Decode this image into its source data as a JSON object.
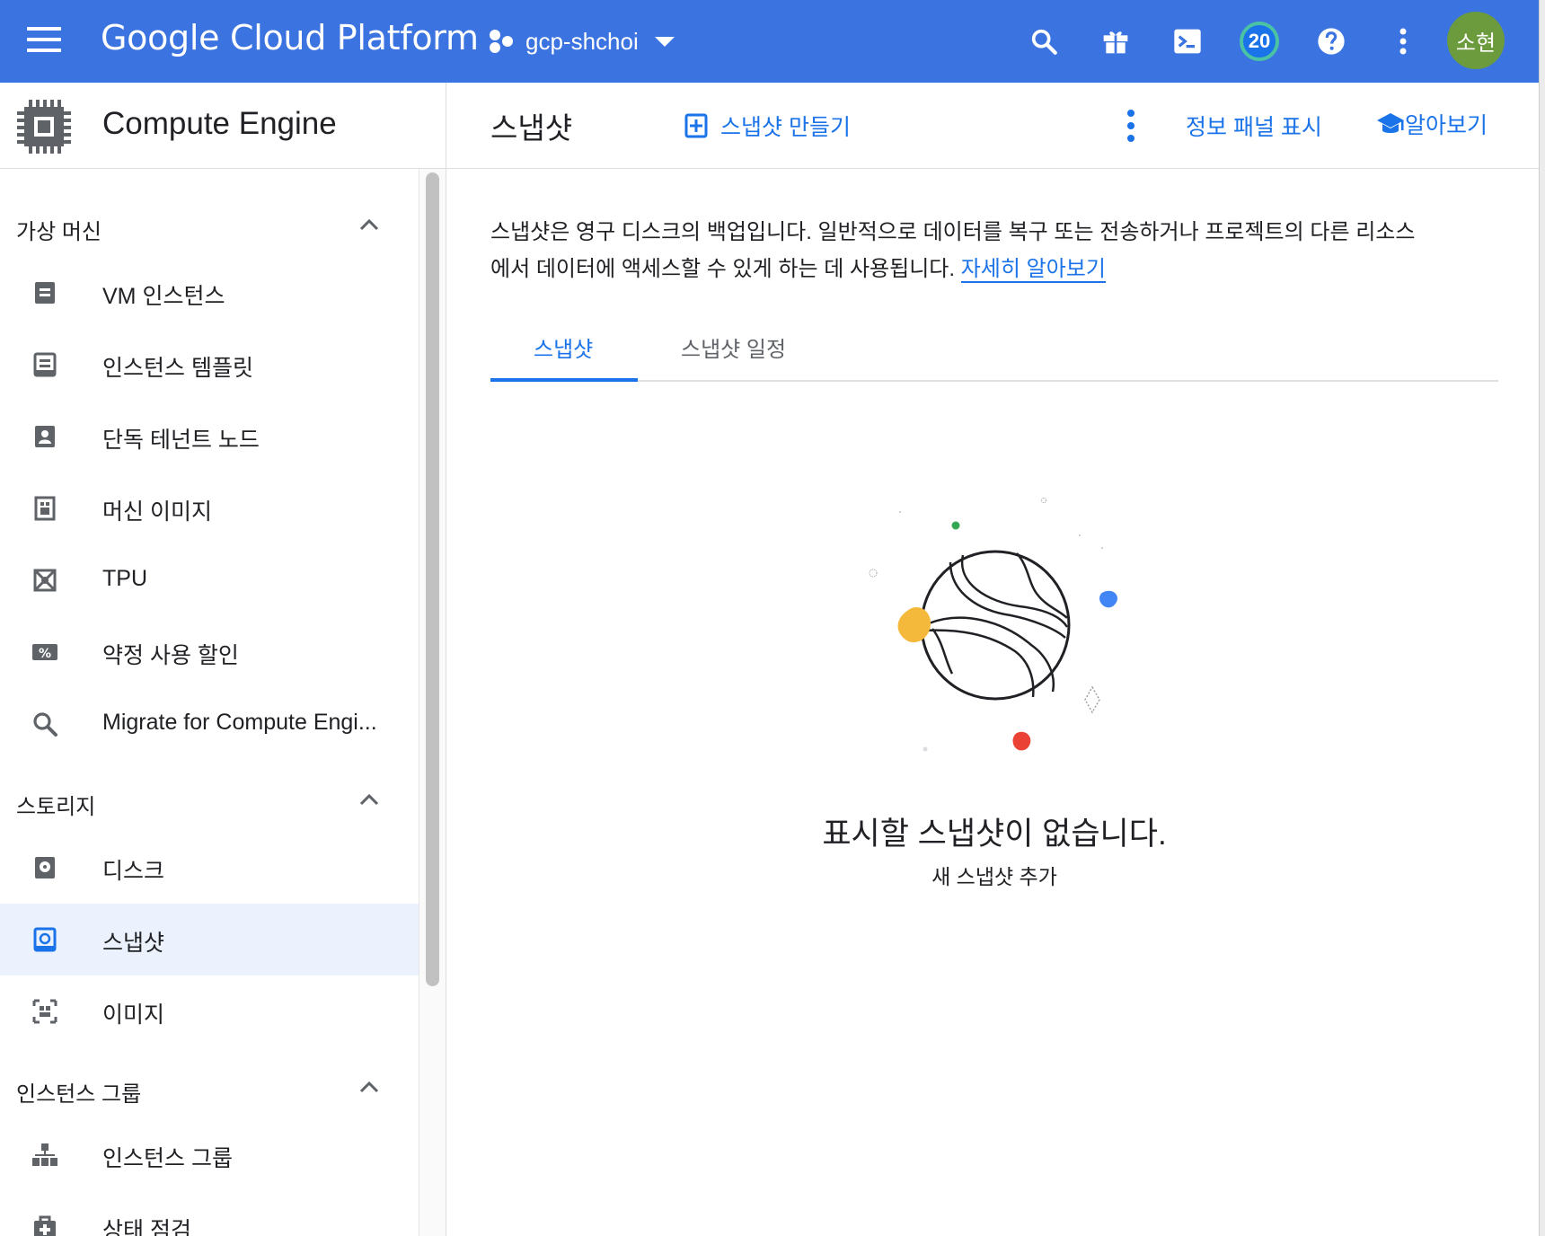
{
  "topbar": {
    "brand": "Google Cloud Platform",
    "project": "gcp-shchoi",
    "notifications_count": "20",
    "avatar_text": "소현"
  },
  "sidebar": {
    "product_title": "Compute Engine",
    "sections": [
      {
        "label": "가상 머신"
      },
      {
        "label": "스토리지"
      },
      {
        "label": "인스턴스 그룹"
      }
    ],
    "items": [
      {
        "label": "VM 인스턴스",
        "icon": "vm-instance-icon"
      },
      {
        "label": "인스턴스 템플릿",
        "icon": "instance-template-icon"
      },
      {
        "label": "단독 테넌트 노드",
        "icon": "sole-tenant-icon"
      },
      {
        "label": "머신 이미지",
        "icon": "machine-image-icon"
      },
      {
        "label": "TPU",
        "icon": "tpu-icon"
      },
      {
        "label": "약정 사용 할인",
        "icon": "percent-icon"
      },
      {
        "label": "Migrate for Compute Engi...",
        "icon": "search-icon"
      },
      {
        "label": "디스크",
        "icon": "disk-icon"
      },
      {
        "label": "스냅샷",
        "icon": "snapshot-icon"
      },
      {
        "label": "이미지",
        "icon": "image-icon"
      },
      {
        "label": "인스턴스 그룹",
        "icon": "instance-group-icon"
      },
      {
        "label": "상태 점검",
        "icon": "health-check-icon"
      }
    ]
  },
  "header": {
    "title": "스냅샷",
    "create_label": "스냅샷 만들기",
    "info_panel_label": "정보 패널 표시",
    "learn_label": "알아보기"
  },
  "main": {
    "description": "스냅샷은 영구 디스크의 백업입니다. 일반적으로 데이터를 복구 또는 전송하거나 프로젝트의 다른 리소스에서 데이터에 액세스할 수 있게 하는 데 사용됩니다. ",
    "learn_more_link": "자세히 알아보기",
    "tabs": [
      {
        "label": "스냅샷",
        "active": true
      },
      {
        "label": "스냅샷 일정",
        "active": false
      }
    ],
    "empty_title": "표시할 스냅샷이 없습니다.",
    "empty_subtitle": "새 스냅샷 추가"
  },
  "colors": {
    "topbar": "#3b73e0",
    "accent": "#1a73e8",
    "active_item_bg": "#ebf1fd",
    "badge_ring": "#4ac2a4",
    "avatar": "#6b9b3c"
  }
}
